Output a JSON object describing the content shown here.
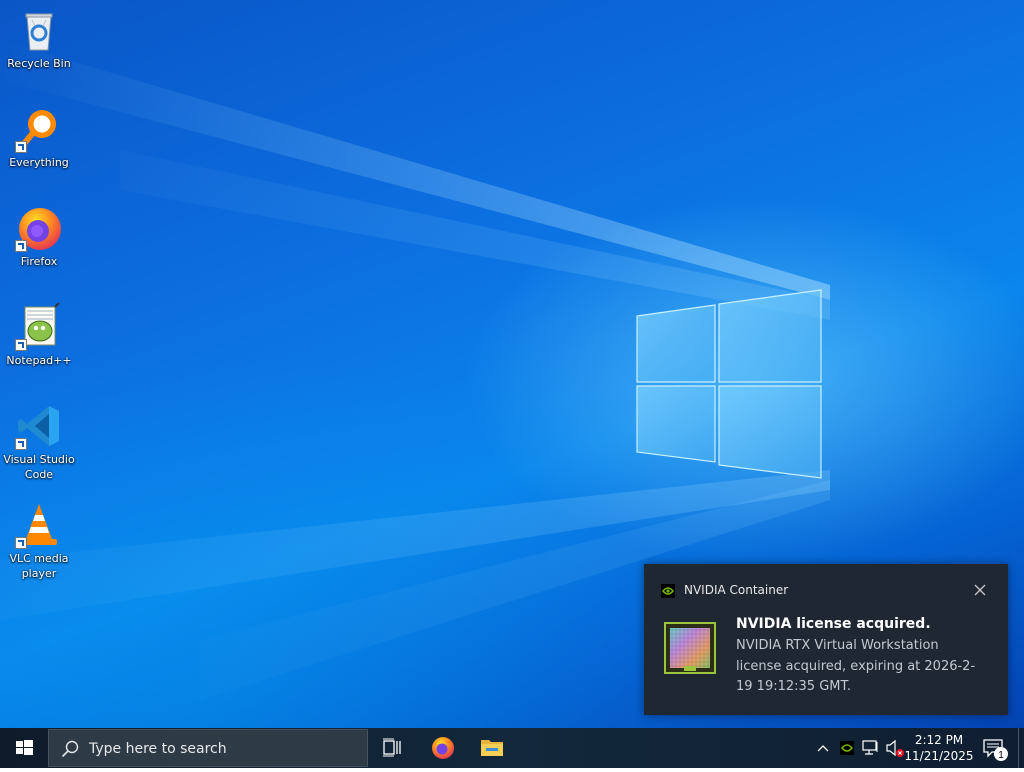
{
  "desktop_icons": [
    {
      "id": "recycle-bin",
      "label": "Recycle Bin",
      "shortcut": false
    },
    {
      "id": "everything",
      "label": "Everything",
      "shortcut": true
    },
    {
      "id": "firefox",
      "label": "Firefox",
      "shortcut": true
    },
    {
      "id": "notepadpp",
      "label": "Notepad++",
      "shortcut": true
    },
    {
      "id": "vscode",
      "label": "Visual Studio Code",
      "shortcut": true
    },
    {
      "id": "vlc",
      "label": "VLC media player",
      "shortcut": true
    }
  ],
  "notification": {
    "app_name": "NVIDIA Container",
    "title": "NVIDIA license acquired.",
    "body": "NVIDIA RTX Virtual Workstation license acquired, expiring at 2026-2-19 19:12:35 GMT.",
    "close_icon": "close-icon",
    "accent": "#76b900"
  },
  "taskbar": {
    "search_placeholder": "Type here to search",
    "pinned": [
      "task-view-icon",
      "firefox-icon",
      "file-explorer-icon"
    ],
    "tray_icons": [
      "show-hidden-icons-chevron",
      "nvidia-tray-icon",
      "network-icon",
      "volume-muted-icon"
    ],
    "time": "2:12 PM",
    "date": "11/21/2025",
    "notification_count": "1"
  },
  "colors": {
    "taskbar_bg": "#10202f",
    "toast_bg": "#1f2733",
    "desktop_blue": "#0a78e6"
  }
}
